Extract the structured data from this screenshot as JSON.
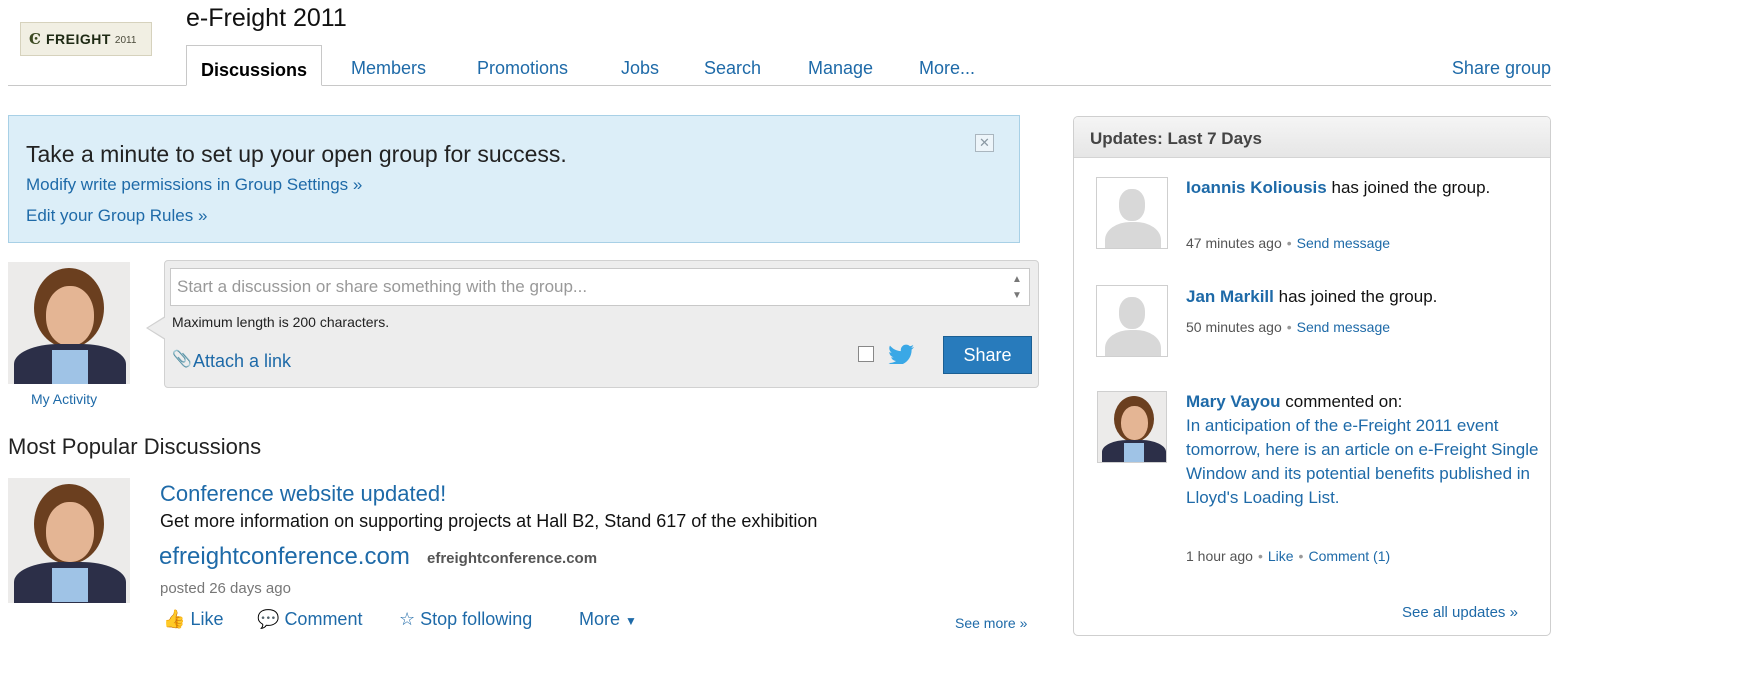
{
  "header": {
    "logo": {
      "mark": "Ͼ",
      "word": "FREIGHT",
      "year": "2011"
    },
    "group_title": "e-Freight 2011",
    "tabs": [
      {
        "label": "Discussions",
        "active": true
      },
      {
        "label": "Members"
      },
      {
        "label": "Promotions"
      },
      {
        "label": "Jobs"
      },
      {
        "label": "Search"
      },
      {
        "label": "Manage"
      },
      {
        "label": "More..."
      }
    ],
    "share_group": "Share group"
  },
  "setup": {
    "title": "Take a minute to set up your open group for success.",
    "link1": "Modify write permissions in Group Settings »",
    "link2": "Edit your Group Rules »",
    "close": "✕"
  },
  "composer": {
    "placeholder": "Start a discussion or share something with the group...",
    "max_length": "Maximum length is 200 characters.",
    "attach_icon": "📎",
    "attach_label": "Attach a link",
    "share_button": "Share",
    "my_activity": "My Activity"
  },
  "popular": {
    "heading": "Most Popular Discussions",
    "post": {
      "title": "Conference website updated!",
      "description": "Get more information on supporting projects at Hall B2, Stand 617 of the exhibition",
      "domain": "efreightconference.com",
      "domain_small": "efreightconference.com",
      "meta": "posted 26 days ago",
      "actions": {
        "like": "Like",
        "comment": "Comment",
        "stop_following": "Stop following",
        "more": "More"
      },
      "see_more": "See more »"
    }
  },
  "updates": {
    "title": "Updates: Last 7 Days",
    "items": [
      {
        "name": "Ioannis Koliousis",
        "text": "has joined the group.",
        "time": "47 minutes ago",
        "action": "Send message"
      },
      {
        "name": "Jan Markill",
        "text": "has joined the group.",
        "time": "50 minutes ago",
        "action": "Send message"
      },
      {
        "name": "Mary Vayou",
        "text": "commented on:",
        "link": "In anticipation of the e-Freight 2011 event tomorrow, here is an article on e-Freight Single Window and its potential benefits published in Lloyd's Loading List.",
        "time": "1 hour ago",
        "like": "Like",
        "comment": "Comment (1)"
      }
    ],
    "see_all": "See all updates »"
  },
  "colors": {
    "link": "#1e6aa8",
    "banner_bg": "#dceef8",
    "share_button": "#287bbc"
  }
}
